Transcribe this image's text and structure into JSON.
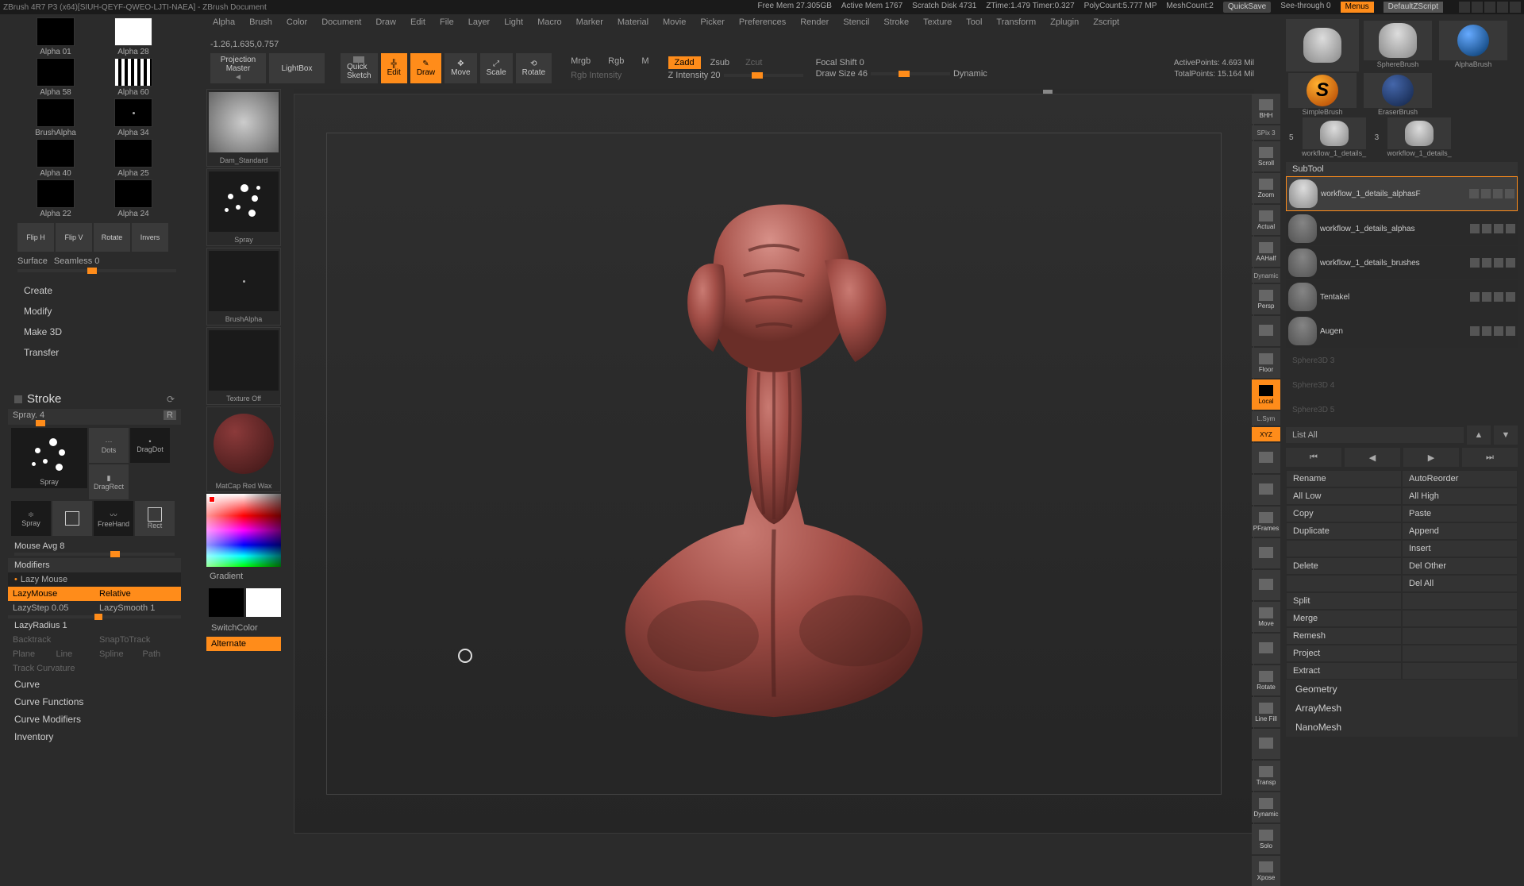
{
  "titlebar": {
    "title": "ZBrush 4R7 P3 (x64)[SIUH-QEYF-QWEO-LJTI-NAEA] - ZBrush Document",
    "stats": {
      "freemem": "Free Mem 27.305GB",
      "activemem": "Active Mem 1767",
      "scratch": "Scratch Disk 4731",
      "ztime": "ZTime:1.479 Timer:0.327",
      "poly": "PolyCount:5.777 MP",
      "mesh": "MeshCount:2"
    },
    "quicksave": "QuickSave",
    "seethrough": "See-through   0",
    "menus": "Menus",
    "script": "DefaultZScript"
  },
  "menubar": [
    "Alpha",
    "Brush",
    "Color",
    "Document",
    "Draw",
    "Edit",
    "File",
    "Layer",
    "Light",
    "Macro",
    "Marker",
    "Material",
    "Movie",
    "Picker",
    "Preferences",
    "Render",
    "Stencil",
    "Stroke",
    "Texture",
    "Tool",
    "Transform",
    "Zplugin",
    "Zscript"
  ],
  "coords": "-1.26,1.635,0.757",
  "alphas": [
    "Alpha 01",
    "Alpha 28",
    "Alpha 58",
    "Alpha 60",
    "BrushAlpha",
    "Alpha 34",
    "Alpha 40",
    "Alpha 25",
    "Alpha 22",
    "Alpha 24"
  ],
  "flip": [
    "Flip H",
    "Flip V",
    "Rotate",
    "Invers"
  ],
  "surface": {
    "label": "Surface",
    "seamless": "Seamless 0"
  },
  "leftmenu": [
    "Create",
    "Modify",
    "Make 3D",
    "Transfer"
  ],
  "stroke": {
    "title": "Stroke",
    "spray": "Spray. 4",
    "icons": {
      "spray": "Spray",
      "dots": "Dots",
      "dragrect": "DragRect",
      "dragdot": "DragDot",
      "spray2": "Spray",
      "freehand": "FreeHand",
      "rect": "Rect"
    },
    "mouseavg": "Mouse Avg 8",
    "modifiers": "Modifiers",
    "lazy": "Lazy Mouse",
    "lazymouse": "LazyMouse",
    "relative": "Relative",
    "lazystep": "LazyStep 0.05",
    "lazysmooth": "LazySmooth 1",
    "lazyradius": "LazyRadius 1",
    "backtrack": "Backtrack",
    "snaptrack": "SnapToTrack",
    "trackrow": [
      "Plane",
      "Line",
      "Spline",
      "Path"
    ],
    "trackcurv": "Track Curvature",
    "curve": "Curve",
    "curvefn": "Curve Functions",
    "curvemod": "Curve Modifiers",
    "inventory": "Inventory"
  },
  "leftshelf": {
    "brush": "Dam_Standard",
    "strokelbl": "Spray",
    "alphalbl": "BrushAlpha",
    "texlbl": "Texture Off",
    "matlbl": "MatCap Red Wax",
    "gradient": "Gradient",
    "switchcolor": "SwitchColor",
    "alternate": "Alternate"
  },
  "topshelf": {
    "projection": "Projection\nMaster",
    "lightbox": "LightBox",
    "qsketch": "Quick\nSketch",
    "edit": "Edit",
    "draw": "Draw",
    "move": "Move",
    "scale": "Scale",
    "rotate": "Rotate",
    "mrgb": "Mrgb",
    "rgb": "Rgb",
    "m": "M",
    "rgbint": "Rgb Intensity",
    "zadd": "Zadd",
    "zsub": "Zsub",
    "zcut": "Zcut",
    "zint": "Z Intensity 20",
    "focal": "Focal Shift 0",
    "drawsize": "Draw Size 46",
    "dynamic": "Dynamic",
    "activepts": "ActivePoints: 4.693 Mil",
    "totalpts": "TotalPoints: 15.164 Mil"
  },
  "rnav": [
    "BHH",
    "SPix 3",
    "Scroll",
    "Zoom",
    "Actual",
    "AAHalf",
    "Dynamic",
    "Persp",
    "",
    "Floor",
    "Local",
    "L.Sym",
    "XYZ",
    "",
    "",
    "PFrames",
    "",
    "",
    "Move",
    "",
    "Rotate",
    "Line Fill",
    "",
    "Transp",
    "Dynamic",
    "Solo",
    "Xpose"
  ],
  "rightshelf": {
    "tools": [
      "SphereBrush",
      "AlphaBrush",
      "SimpleBrush",
      "EraserBrush",
      "workflow_1_details_",
      "workflow_1_details_"
    ],
    "spix": "5",
    "subtool_h": "SubTool",
    "subtools": [
      "workflow_1_details_alphasF",
      "workflow_1_details_alphas",
      "workflow_1_details_brushes",
      "Tentakel",
      "Augen",
      "Sphere3D 3",
      "Sphere3D 4",
      "Sphere3D 5"
    ],
    "listall": "List All",
    "actions": [
      "Rename",
      "AutoReorder",
      "All Low",
      "All High",
      "Copy",
      "Paste",
      "Duplicate",
      "Append",
      "",
      "Insert",
      "Delete",
      "Del Other",
      "",
      "Del All",
      "Split",
      "",
      "Merge",
      "",
      "Remesh",
      "",
      "Project",
      "",
      "Extract",
      ""
    ],
    "geo": [
      "Geometry",
      "ArrayMesh",
      "NanoMesh"
    ]
  }
}
